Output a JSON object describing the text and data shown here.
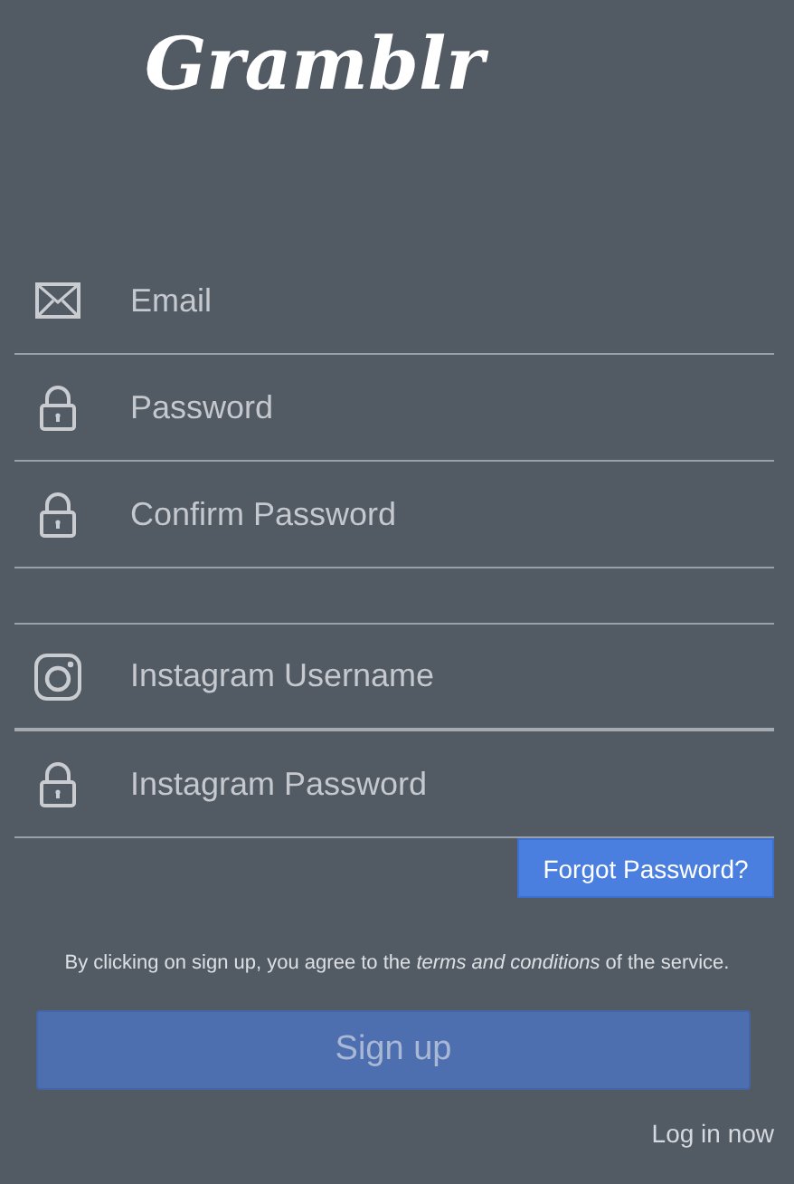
{
  "logo": "Gramblr",
  "field_groups": [
    {
      "fields": [
        {
          "kind": "email",
          "placeholder": "Email"
        },
        {
          "kind": "password",
          "placeholder": "Password"
        },
        {
          "kind": "password",
          "placeholder": "Confirm Password"
        }
      ]
    },
    {
      "fields": [
        {
          "kind": "instagram",
          "placeholder": "Instagram Username"
        },
        {
          "kind": "password",
          "placeholder": "Instagram Password"
        }
      ]
    }
  ],
  "forgot_button": "Forgot Password?",
  "terms": "By clicking on sign up, you agree to the *terms and conditions* of the service.",
  "signup_button": "Sign up",
  "login_link": "Log in now"
}
